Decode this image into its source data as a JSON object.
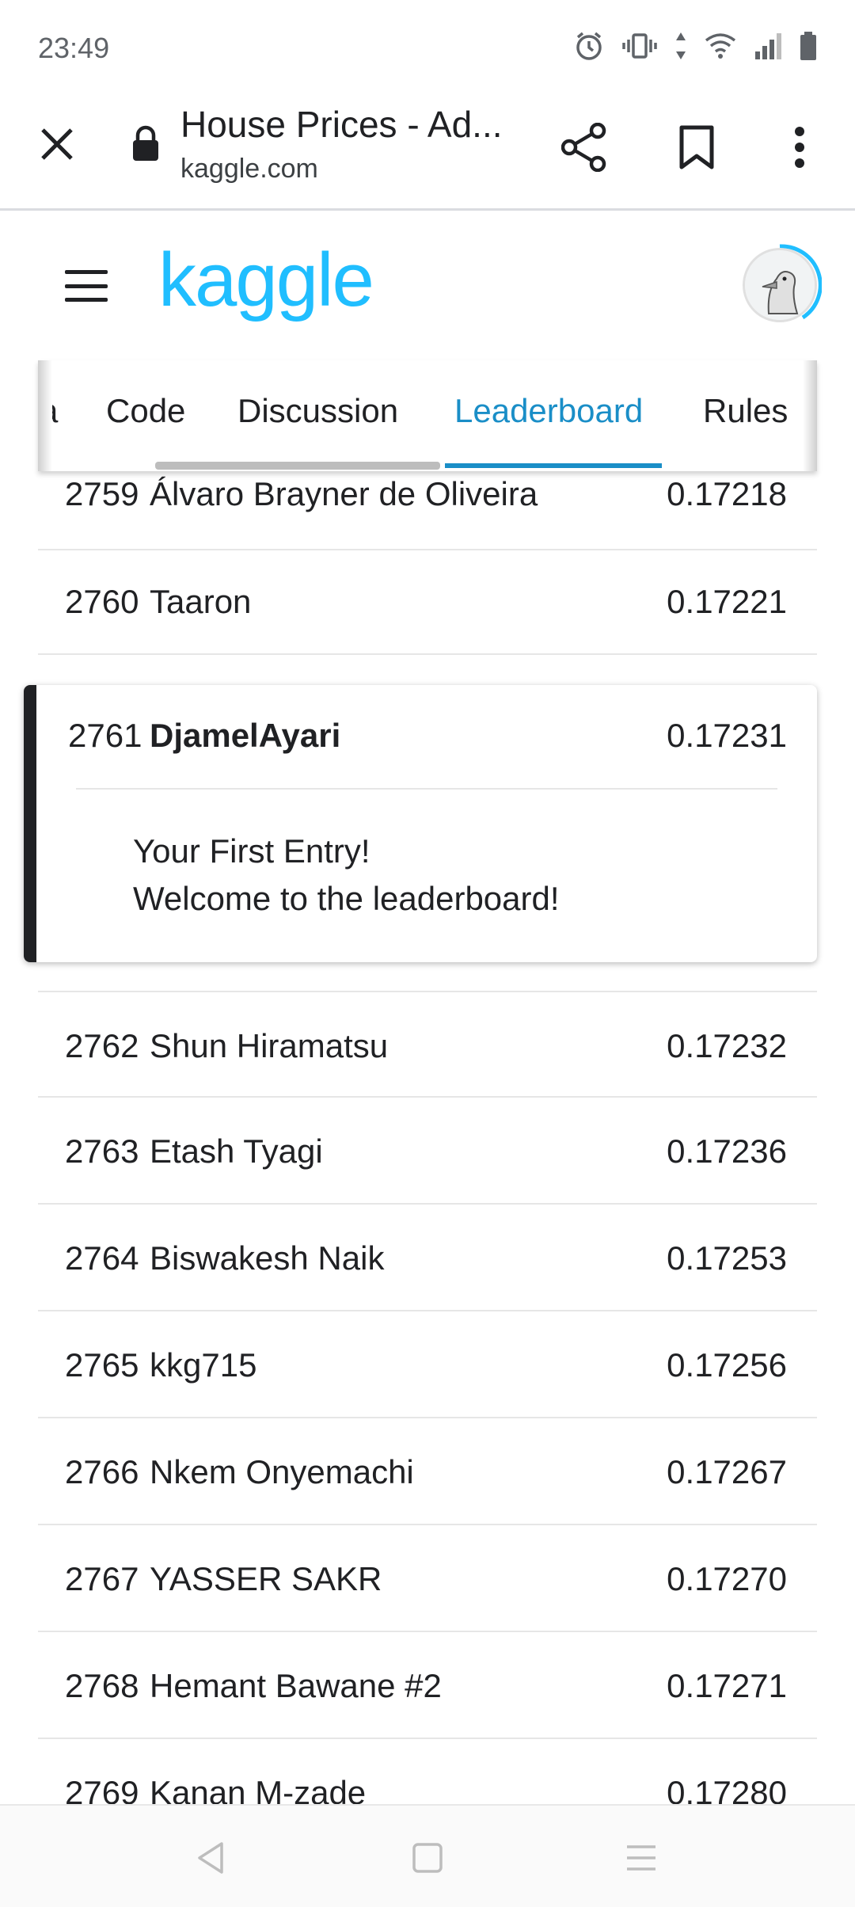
{
  "status_bar": {
    "time": "23:49",
    "icons": [
      "alarm-icon",
      "vibrate-icon",
      "data-arrows-icon",
      "wifi-icon",
      "signal-icon",
      "battery-icon"
    ]
  },
  "browser": {
    "page_title": "House Prices - Ad...",
    "domain": "kaggle.com",
    "icons": [
      "close-icon",
      "lock-icon",
      "share-icon",
      "bookmark-icon",
      "more-vert-icon"
    ]
  },
  "header": {
    "logo_text": "kaggle",
    "logo_color": "#20beff"
  },
  "tabs": [
    {
      "label": "a",
      "active": false
    },
    {
      "label": "Code",
      "active": false
    },
    {
      "label": "Discussion",
      "active": false
    },
    {
      "label": "Leaderboard",
      "active": true
    },
    {
      "label": "Rules",
      "active": false
    }
  ],
  "leaderboard": {
    "rows_before": [
      {
        "rank": "2759",
        "name": "Álvaro Brayner de Oliveira",
        "score": "0.17218"
      },
      {
        "rank": "2760",
        "name": "Taaron",
        "score": "0.17221"
      }
    ],
    "my_entry": {
      "rank": "2761",
      "name": "DjamelAyari",
      "score": "0.17231",
      "message_line1": "Your First Entry!",
      "message_line2": "Welcome to the leaderboard!"
    },
    "rows_after": [
      {
        "rank": "2762",
        "name": "Shun Hiramatsu",
        "score": "0.17232"
      },
      {
        "rank": "2763",
        "name": "Etash Tyagi",
        "score": "0.17236"
      },
      {
        "rank": "2764",
        "name": "Biswakesh Naik",
        "score": "0.17253"
      },
      {
        "rank": "2765",
        "name": "kkg715",
        "score": "0.17256"
      },
      {
        "rank": "2766",
        "name": "Nkem Onyemachi",
        "score": "0.17267"
      },
      {
        "rank": "2767",
        "name": "YASSER SAKR",
        "score": "0.17270"
      },
      {
        "rank": "2768",
        "name": "Hemant Bawane #2",
        "score": "0.17271"
      },
      {
        "rank": "2769",
        "name": "Kanan M-zade",
        "score": "0.17280"
      }
    ]
  },
  "nav_bar": {
    "icons": [
      "back-icon",
      "home-icon",
      "recents-icon"
    ]
  },
  "colors": {
    "accent": "#1a8ec7",
    "text": "#202124"
  }
}
